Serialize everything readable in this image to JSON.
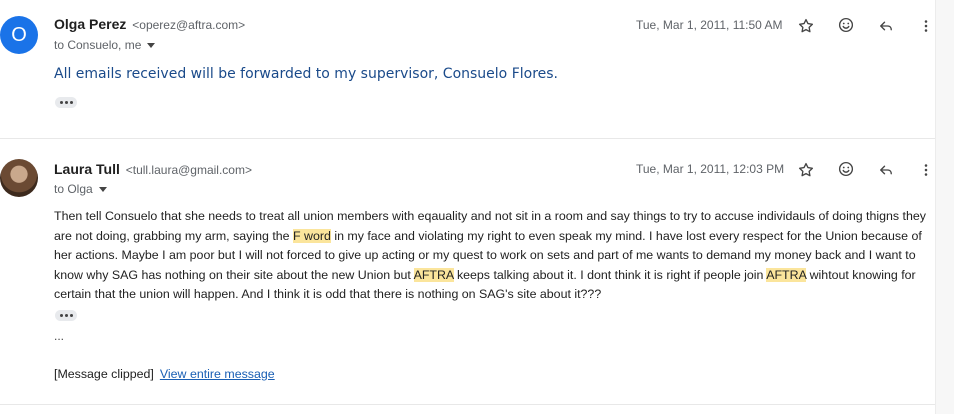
{
  "messages": [
    {
      "sender_name": "Olga Perez",
      "sender_email": "<operez@aftra.com>",
      "avatar_letter": "O",
      "to": "to Consuelo, me",
      "date": "Tue, Mar 1, 2011, 11:50 AM",
      "body": "All emails received will be forwarded to my supervisor, Consuelo Flores."
    },
    {
      "sender_name": "Laura Tull",
      "sender_email": "<tull.laura@gmail.com>",
      "to": "to Olga",
      "date": "Tue, Mar 1, 2011, 12:03 PM",
      "body_parts": [
        "Then tell Consuelo that she needs to treat all union members with eqauality and not sit in a room and say things to try to accuse individauls of doing thigns they are not doing, grabbing my arm, saying the ",
        "F word",
        " in my face and violating my right to even speak my mind.  I have lost every respect for the Union because of her actions.  Maybe I am poor but I will not forced to give up acting or my quest to work on sets and part of me wants to demand my money back and I want to know why SAG has nothing on their site about the new Union but ",
        "AFTRA",
        " keeps talking about it.  I dont think it is right if people join ",
        "AFTRA",
        " wihtout knowing for certain that the union will happen.  And I think it is odd that there is nothing on SAG's site about it???"
      ],
      "ellipsis": "...",
      "clipped_text": "[Message clipped]",
      "view_entire_link": "View entire message"
    }
  ],
  "icons": [
    "star-icon",
    "smiley-icon",
    "reply-icon",
    "more-vert-icon",
    "more-horiz-icon",
    "caret-down-icon"
  ],
  "colors": {
    "avatar": "#1a73e8",
    "highlight": "#fbe59c",
    "link": "#1a5fb4",
    "handwriting": "#1a4a8a"
  }
}
